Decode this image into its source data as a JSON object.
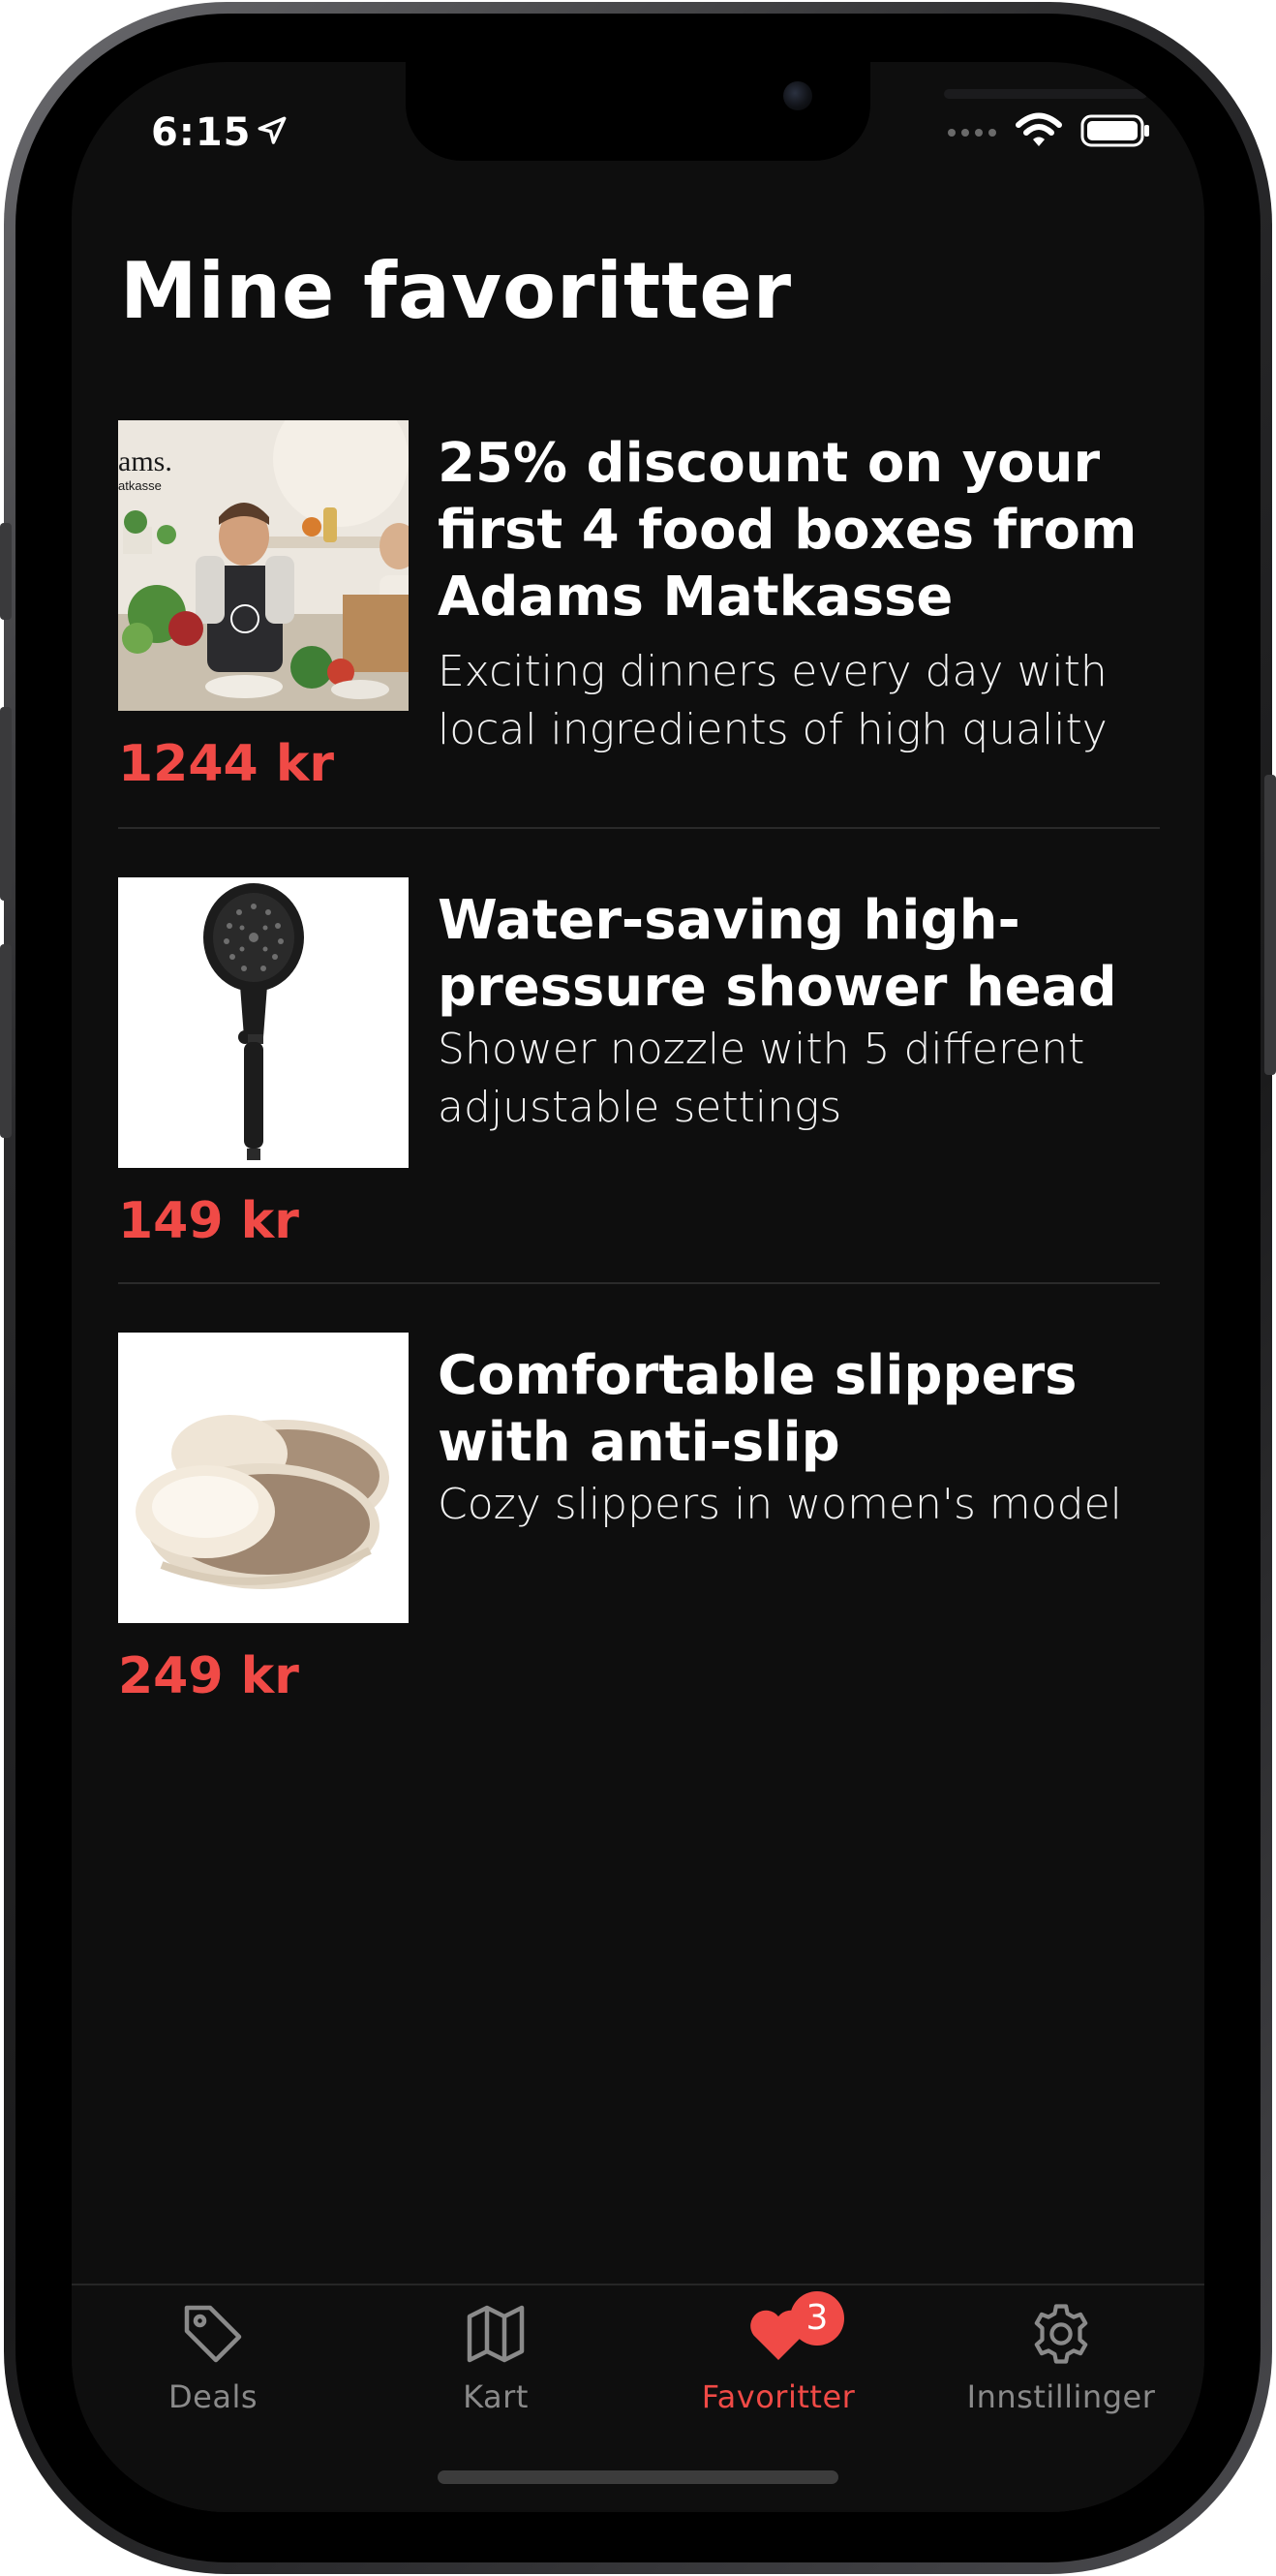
{
  "status_bar": {
    "time": "6:15",
    "location_icon": "location-arrow-icon",
    "signal_icon": "cellular-dots-icon",
    "wifi_icon": "wifi-icon",
    "battery_icon": "battery-icon"
  },
  "page": {
    "title": "Mine favoritter"
  },
  "favorites": [
    {
      "title": "25% discount on your first 4 food boxes from Adams Matkasse",
      "description": "Exciting dinners every day with local ingredients of high quality",
      "price": "1244 kr",
      "image": {
        "brand_text": "ams.",
        "sub_text": "atkasse",
        "box_text": "Adams."
      }
    },
    {
      "title": "Water-saving high-pressure shower head",
      "description": "Shower nozzle with 5 different adjustable settings",
      "price": "149 kr"
    },
    {
      "title": "Comfortable slippers with anti-slip",
      "description": "Cozy slippers in women's model",
      "price": "249 kr"
    }
  ],
  "tab_bar": {
    "tabs": [
      {
        "label": "Deals",
        "icon": "tag-icon",
        "active": false
      },
      {
        "label": "Kart",
        "icon": "map-icon",
        "active": false
      },
      {
        "label": "Favoritter",
        "icon": "heart-icon",
        "active": true,
        "badge": "3"
      },
      {
        "label": "Innstillinger",
        "icon": "gear-icon",
        "active": false
      }
    ]
  },
  "colors": {
    "background": "#0e0e0e",
    "accent": "#f04a46",
    "text": "#ffffff",
    "inactive_tab": "#8a8a8a"
  }
}
